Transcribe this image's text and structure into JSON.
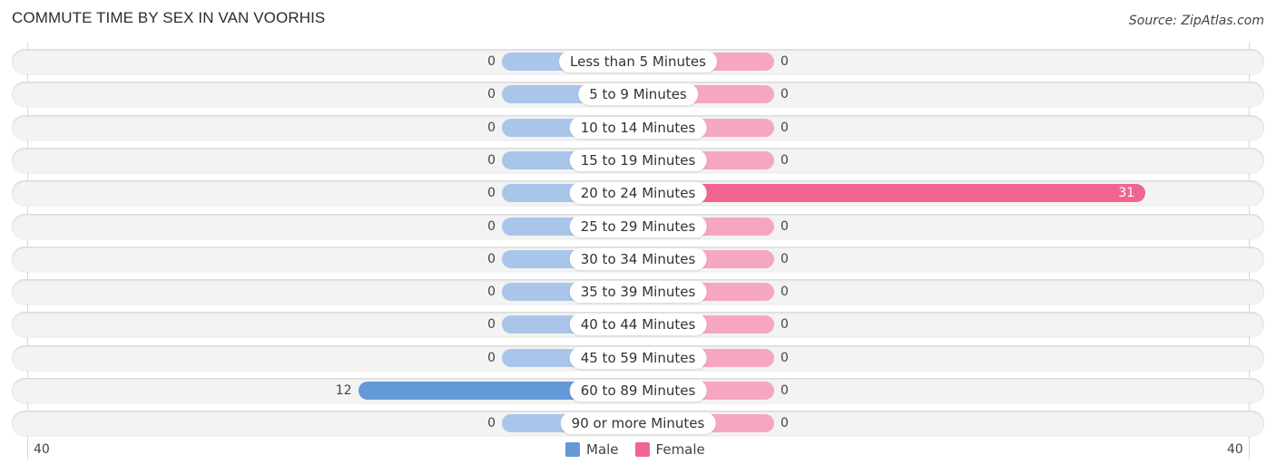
{
  "chart_data": {
    "type": "bar",
    "orientation": "horizontal-diverging",
    "title": "COMMUTE TIME BY SEX IN VAN VOORHIS",
    "source": "Source: ZipAtlas.com",
    "categories": [
      "Less than 5 Minutes",
      "5 to 9 Minutes",
      "10 to 14 Minutes",
      "15 to 19 Minutes",
      "20 to 24 Minutes",
      "25 to 29 Minutes",
      "30 to 34 Minutes",
      "35 to 39 Minutes",
      "40 to 44 Minutes",
      "45 to 59 Minutes",
      "60 to 89 Minutes",
      "90 or more Minutes"
    ],
    "series": [
      {
        "name": "Male",
        "color": "#6499d8",
        "light_color": "#a9c6ea",
        "values": [
          0,
          0,
          0,
          0,
          0,
          0,
          0,
          0,
          0,
          0,
          12,
          0
        ]
      },
      {
        "name": "Female",
        "color": "#f06690",
        "light_color": "#f6a7c0",
        "values": [
          0,
          0,
          0,
          0,
          31,
          0,
          0,
          0,
          0,
          0,
          0,
          0
        ]
      }
    ],
    "axis": {
      "left_tick": "40",
      "right_tick": "40",
      "range": [
        0,
        40
      ]
    },
    "legend": {
      "position": "bottom-center",
      "items": [
        "Male",
        "Female"
      ]
    },
    "grid": false
  }
}
